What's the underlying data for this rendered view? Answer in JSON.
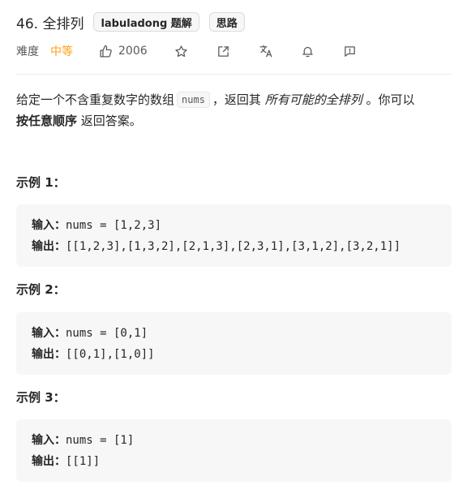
{
  "header": {
    "title": "46. 全排列",
    "tags": [
      "labuladong 题解",
      "思路"
    ]
  },
  "meta": {
    "difficulty_label": "难度",
    "difficulty": "中等",
    "likes": "2006",
    "icons": [
      "thumb-up-icon",
      "star-icon",
      "share-icon",
      "translate-icon",
      "bell-icon",
      "feedback-icon"
    ],
    "difficulty_color": "#ffa116"
  },
  "description": {
    "part1": "给定一个不含重复数字的数组",
    "code": "nums",
    "part2": "，返回其",
    "emphasis": "所有可能的全排列",
    "part3": "。你可以",
    "bold": "按任意顺序",
    "part4": "返回答案。"
  },
  "examples": [
    {
      "title": "示例 1：",
      "input_label": "输入：",
      "input": "nums = [1,2,3]",
      "output_label": "输出：",
      "output": "[[1,2,3],[1,3,2],[2,1,3],[2,3,1],[3,1,2],[3,2,1]]"
    },
    {
      "title": "示例 2：",
      "input_label": "输入：",
      "input": "nums = [0,1]",
      "output_label": "输出：",
      "output": "[[0,1],[1,0]]"
    },
    {
      "title": "示例 3：",
      "input_label": "输入：",
      "input": "nums = [1]",
      "output_label": "输出：",
      "output": "[[1]]"
    }
  ]
}
